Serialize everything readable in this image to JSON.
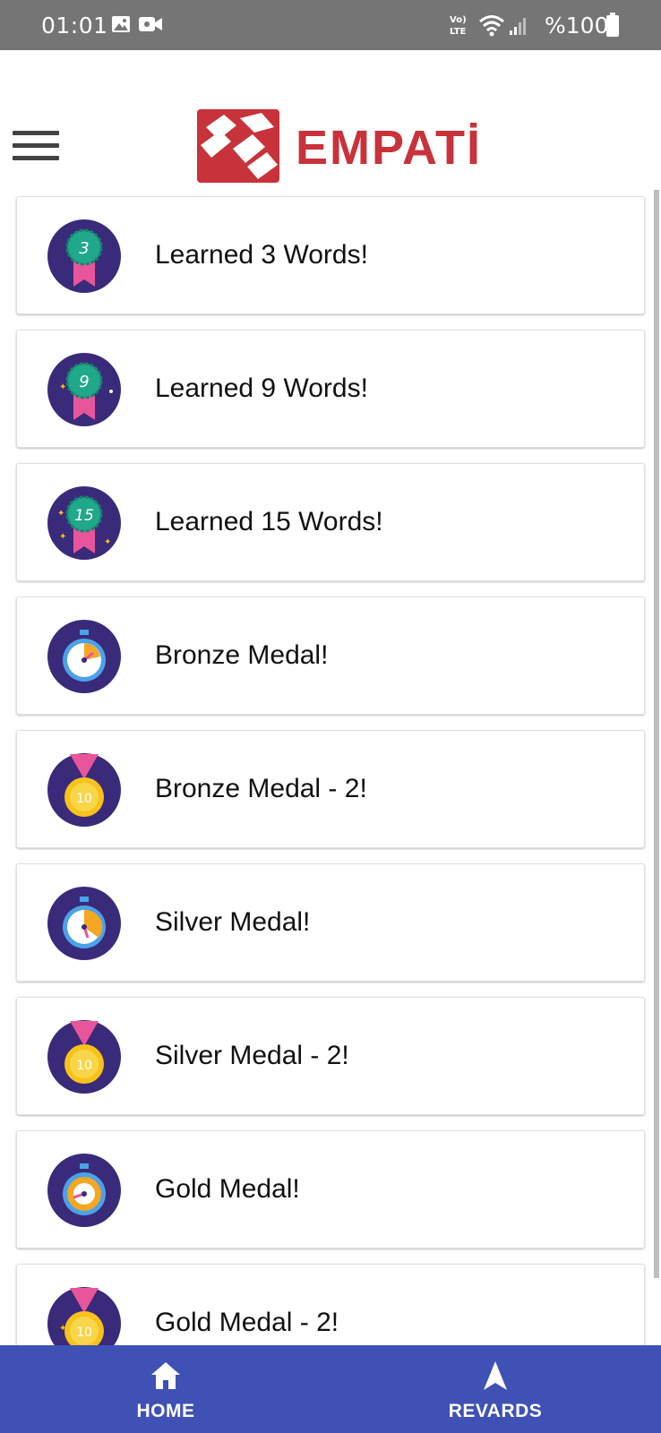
{
  "status_bar": {
    "time": "01:01",
    "battery": "%100",
    "icons": [
      "gallery-icon",
      "video-camera-icon",
      "volte-icon",
      "wifi-icon",
      "signal-icon",
      "battery-icon"
    ]
  },
  "header": {
    "menu_icon": "hamburger-menu-icon",
    "logo_text": "EMPATİ"
  },
  "rewards": [
    {
      "label": "Learned 3 Words!",
      "icon": "ribbon-badge-icon",
      "badge_text": "3"
    },
    {
      "label": "Learned 9 Words!",
      "icon": "ribbon-badge-icon",
      "badge_text": "9"
    },
    {
      "label": "Learned 15 Words!",
      "icon": "ribbon-badge-icon",
      "badge_text": "15"
    },
    {
      "label": "Bronze Medal!",
      "icon": "stopwatch-icon"
    },
    {
      "label": "Bronze Medal - 2!",
      "icon": "medal-icon",
      "badge_text": "10"
    },
    {
      "label": "Silver Medal!",
      "icon": "stopwatch-icon"
    },
    {
      "label": "Silver Medal - 2!",
      "icon": "medal-icon",
      "badge_text": "10"
    },
    {
      "label": "Gold Medal!",
      "icon": "stopwatch-icon"
    },
    {
      "label": "Gold Medal - 2!",
      "icon": "medal-icon",
      "badge_text": "10"
    }
  ],
  "bottom_nav": {
    "home_label": "HOME",
    "rewards_label": "REVARDS"
  },
  "colors": {
    "status_bar": "#757575",
    "brand_red": "#c8323a",
    "nav_blue": "#3f51b5",
    "badge_purple": "#3a2a7a",
    "badge_teal": "#1fa88a",
    "ribbon_pink": "#e9559a",
    "medal_gold": "#f7c21a"
  }
}
